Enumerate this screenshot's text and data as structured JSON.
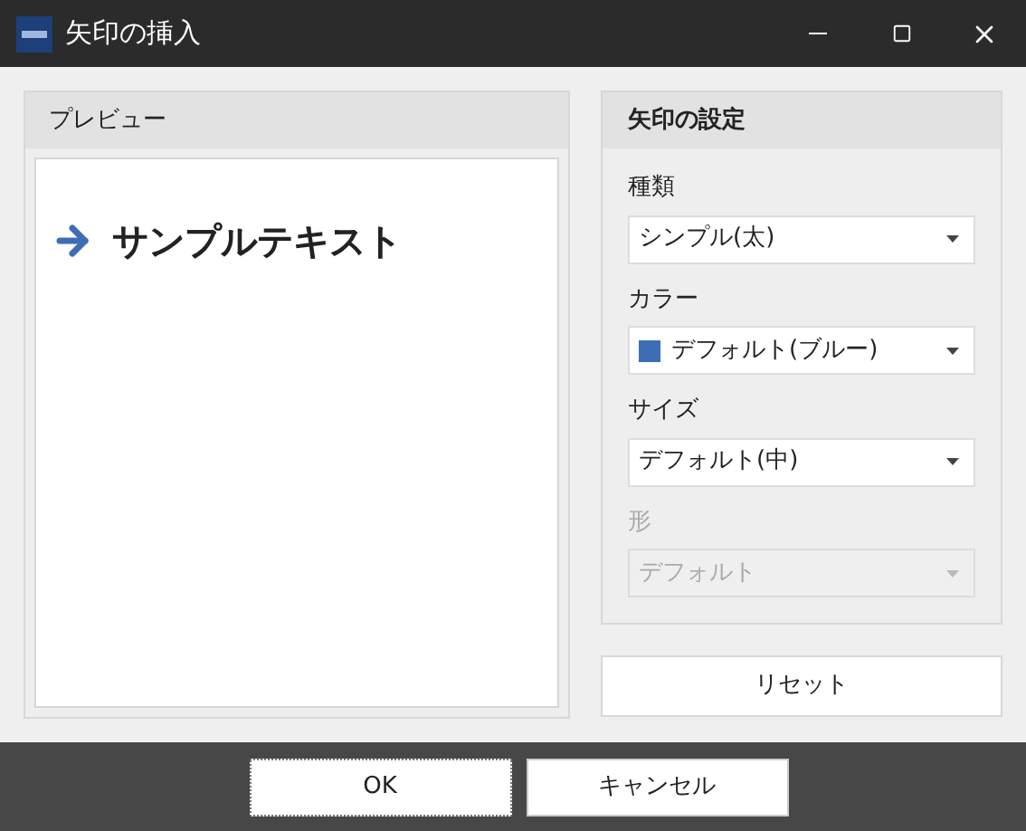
{
  "window": {
    "title": "矢印の挿入"
  },
  "preview": {
    "title": "プレビュー",
    "sample_text": "サンプルテキスト"
  },
  "settings": {
    "title": "矢印の設定",
    "fields": [
      {
        "label": "種類",
        "value": "シンプル(太)",
        "disabled": false
      },
      {
        "label": "カラー",
        "value": "デフォルト(ブルー)",
        "disabled": false,
        "color": "#3d6db5"
      },
      {
        "label": "サイズ",
        "value": "デフォルト(中)",
        "disabled": false
      },
      {
        "label": "形",
        "value": "デフォルト",
        "disabled": true
      }
    ]
  },
  "reset_button": "リセット",
  "buttons": [
    {
      "label": "OK",
      "focused": true
    },
    {
      "label": "キャンセル",
      "focused": false
    }
  ]
}
